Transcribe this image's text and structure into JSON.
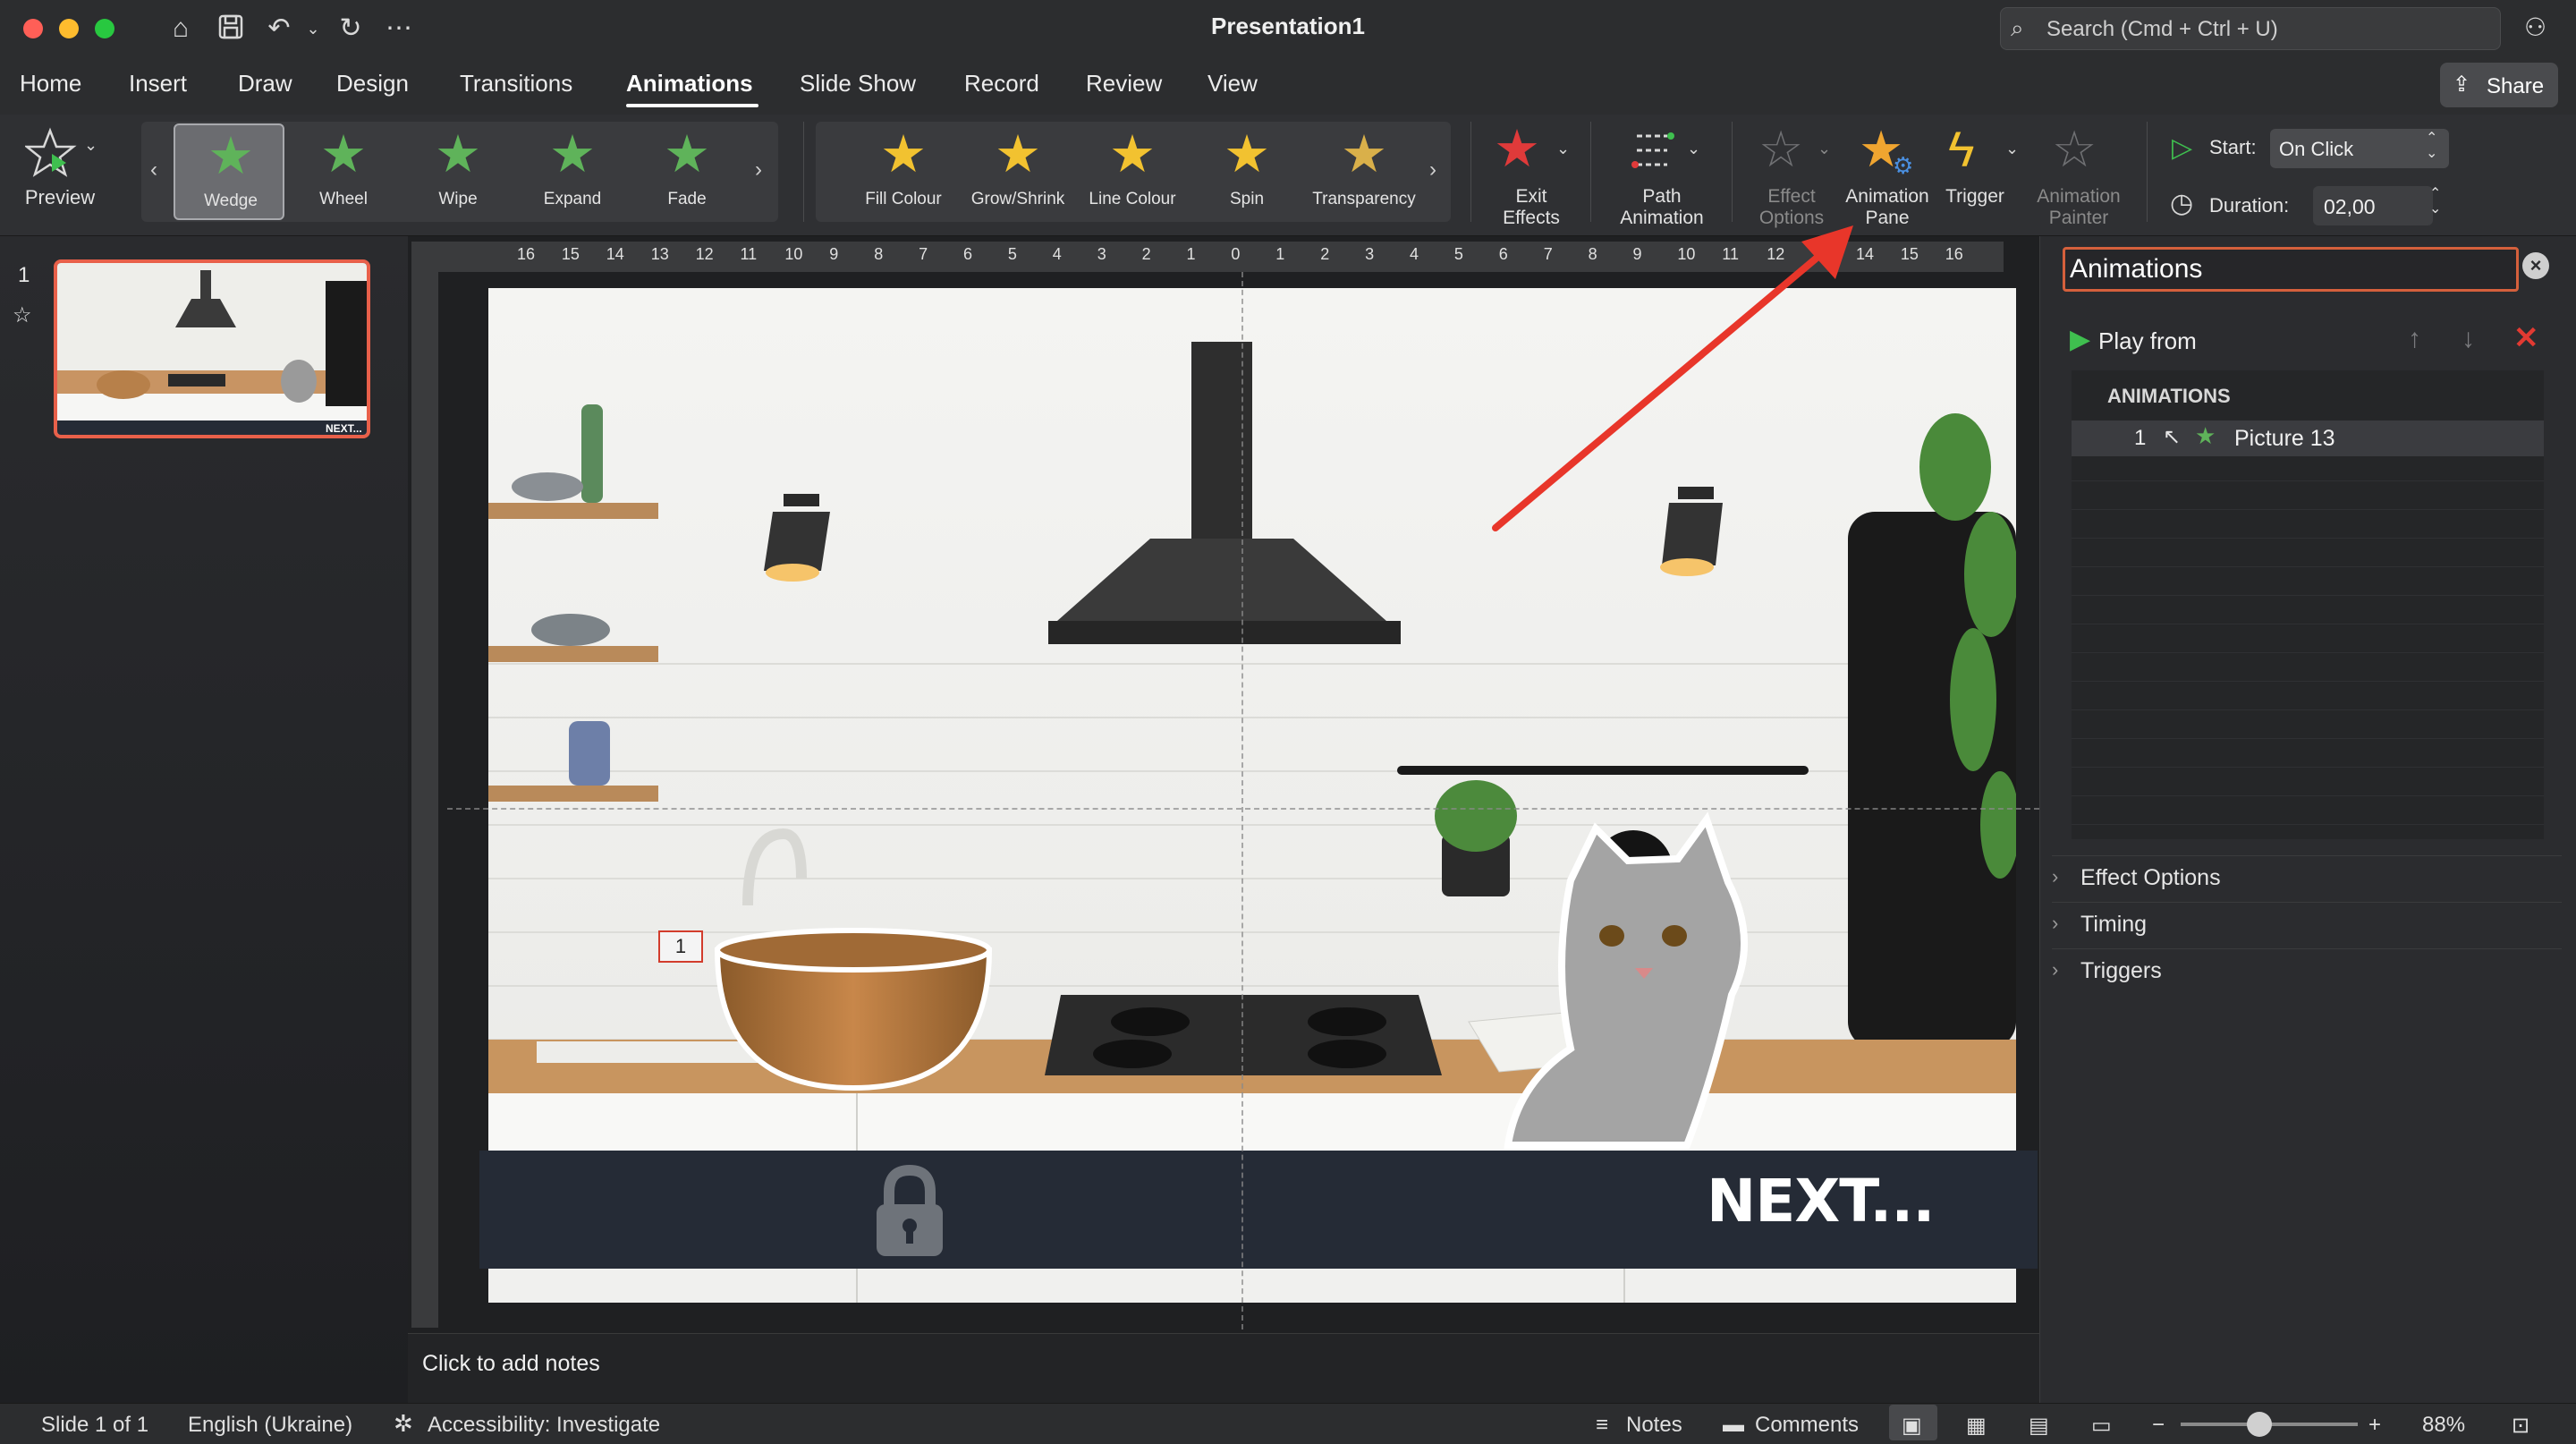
{
  "app": {
    "title": "Presentation1"
  },
  "search": {
    "placeholder": "Search (Cmd + Ctrl + U)"
  },
  "tabs": [
    {
      "label": "Home"
    },
    {
      "label": "Insert"
    },
    {
      "label": "Draw"
    },
    {
      "label": "Design"
    },
    {
      "label": "Transitions"
    },
    {
      "label": "Animations"
    },
    {
      "label": "Slide Show"
    },
    {
      "label": "Record"
    },
    {
      "label": "Review"
    },
    {
      "label": "View"
    }
  ],
  "share": {
    "label": "Share"
  },
  "ribbon": {
    "preview": "Preview",
    "entrance": [
      "Wedge",
      "Wheel",
      "Wipe",
      "Expand",
      "Fade"
    ],
    "emphasis": [
      "Fill Colour",
      "Grow/Shrink",
      "Line Colour",
      "Spin",
      "Transparency"
    ],
    "exit_effects_1": "Exit",
    "exit_effects_2": "Effects",
    "path_animation_1": "Path",
    "path_animation_2": "Animation",
    "effect_options_1": "Effect",
    "effect_options_2": "Options",
    "animation_pane_1": "Animation",
    "animation_pane_2": "Pane",
    "trigger": "Trigger",
    "animation_painter_1": "Animation",
    "animation_painter_2": "Painter",
    "start_label": "Start:",
    "start_value": "On Click",
    "duration_label": "Duration:",
    "duration_value": "02,00"
  },
  "ruler": {
    "ticks": [
      "16",
      "15",
      "14",
      "13",
      "12",
      "11",
      "10",
      "9",
      "8",
      "7",
      "6",
      "5",
      "4",
      "3",
      "2",
      "1",
      "0",
      "1",
      "2",
      "3",
      "4",
      "5",
      "6",
      "7",
      "8",
      "9",
      "10",
      "11",
      "12",
      "13",
      "14",
      "15",
      "16"
    ]
  },
  "thumbnails": [
    {
      "number": "1",
      "caption": "NEXT..."
    }
  ],
  "slide": {
    "banner_text": "NEXT...",
    "anim_tag": "1"
  },
  "notes": {
    "placeholder": "Click to add notes"
  },
  "anim_pane": {
    "title": "Animations",
    "play_from": "Play from",
    "list_header": "ANIMATIONS",
    "items": [
      {
        "index": "1",
        "name": "Picture 13"
      }
    ],
    "sections": [
      "Effect Options",
      "Timing",
      "Triggers"
    ]
  },
  "status": {
    "slide": "Slide 1 of 1",
    "language": "English (Ukraine)",
    "accessibility": "Accessibility: Investigate",
    "notes": "Notes",
    "comments": "Comments",
    "zoom": "88%"
  },
  "colors": {
    "accent_red": "#e8604a",
    "star_green": "#5fb35a",
    "star_gold": "#f2c230",
    "play_green": "#3fbf4f"
  }
}
